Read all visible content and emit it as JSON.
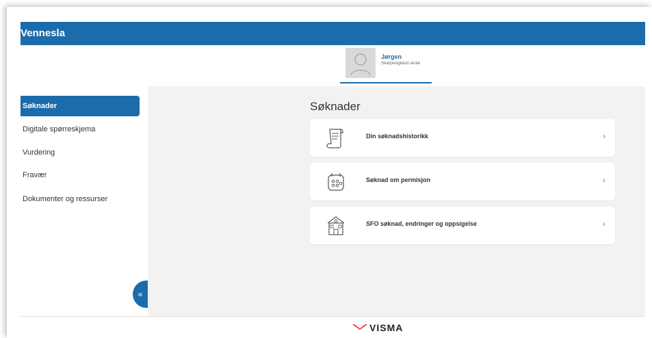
{
  "app": {
    "title": "Vennesla"
  },
  "profile": {
    "name": "Jørgen",
    "school": "Skarpengland skole"
  },
  "sidebar": {
    "items": [
      {
        "label": "Søknader",
        "active": true
      },
      {
        "label": "Digitale spørreskjema"
      },
      {
        "label": "Vurdering"
      },
      {
        "label": "Fravær"
      },
      {
        "label": "Dokumenter og ressurser"
      }
    ],
    "collapse_icon": "double-chevron-left-icon",
    "collapse_label": "«"
  },
  "main": {
    "title": "Søknader",
    "cards": [
      {
        "label": "Din søknadshistorikk",
        "icon": "scroll-icon"
      },
      {
        "label": "Søknad om permisjon",
        "icon": "calendar-icon"
      },
      {
        "label": "SFO søknad, endringer og oppsigelse",
        "icon": "school-building-icon"
      }
    ],
    "chevron": "›"
  },
  "footer": {
    "brand": "VISMA"
  },
  "colors": {
    "accent": "#1c6bab",
    "visma_red": "#e8312f",
    "chevron": "#3a8fd8"
  }
}
